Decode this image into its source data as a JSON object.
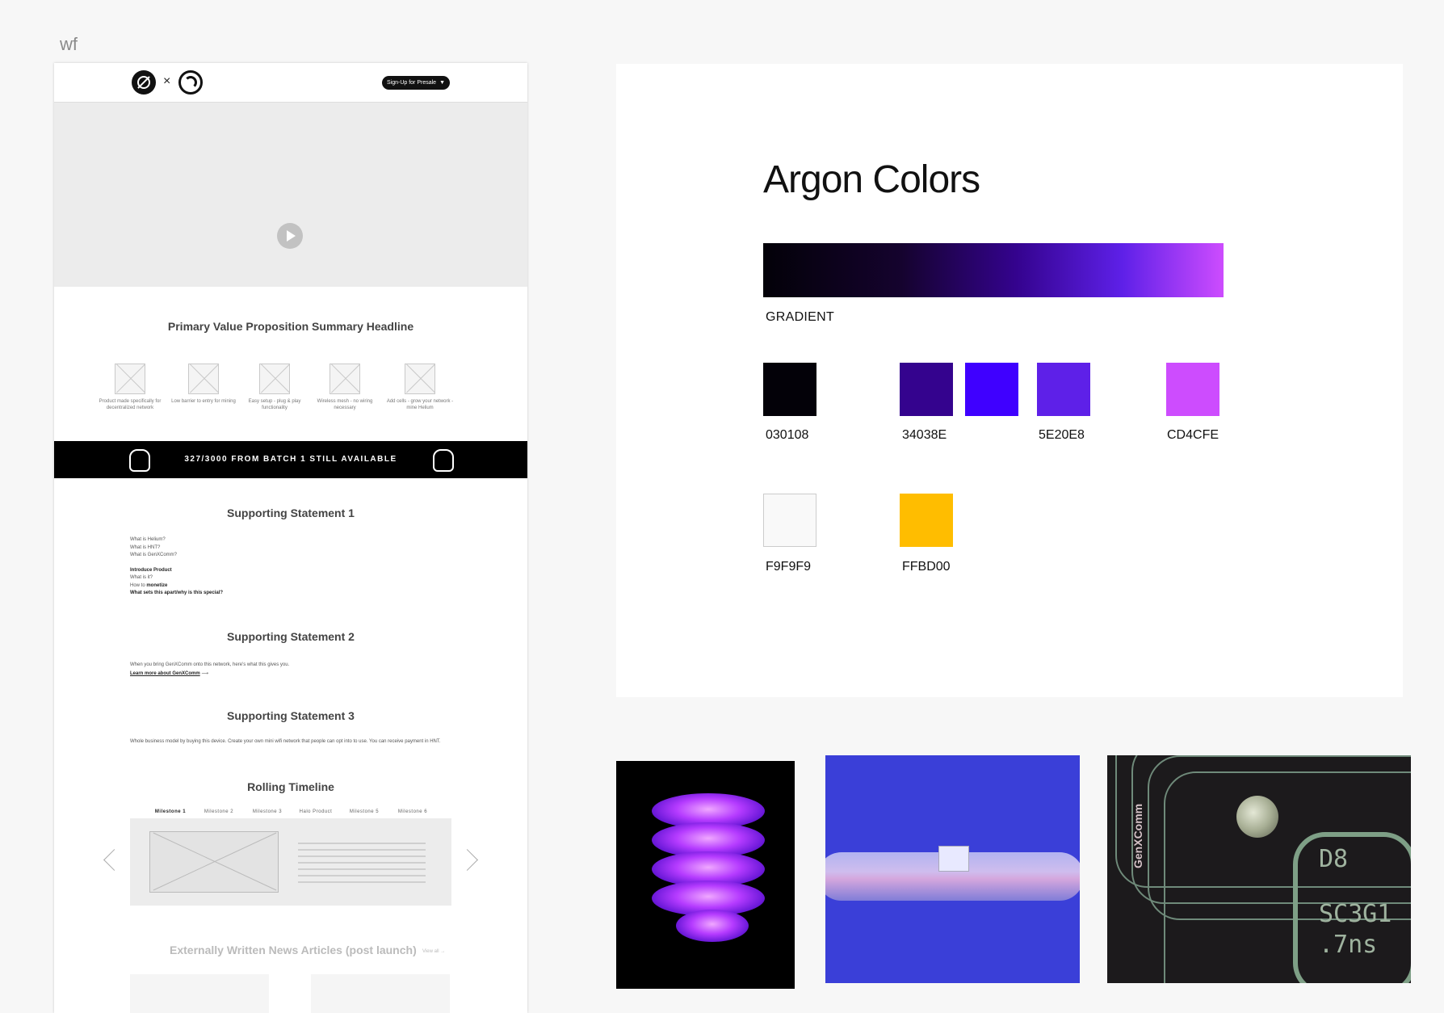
{
  "frame_label": "wf",
  "wireframe": {
    "nav": {
      "separator": "×",
      "presale_label": "Sign-Up for Presale",
      "presale_caret": "▼"
    },
    "value_prop_title": "Primary Value Proposition Summary Headline",
    "features": [
      "Product made specifically for decentralized network",
      "Low barrier to entry for mining",
      "Easy setup - plug & play functionality",
      "Wireless mesh - no wiring necessary",
      "Add cells - grow your network - mine Helium"
    ],
    "banner_text": "327/3000 FROM BATCH 1 STILL AVAILABLE",
    "support1": {
      "title": "Supporting Statement 1",
      "lines": [
        "What is Helium?",
        "What is HNT?",
        "What is GenXComm?"
      ],
      "intro": "Introduce Product",
      "intro_lines_1": "What is it?",
      "how_to": "How to ",
      "monetize": "monetize",
      "special": "What sets this apart/why is this special?"
    },
    "support2": {
      "title": "Supporting Statement 2",
      "body": "When you bring GenXComm onto this network, here's what this gives you.",
      "link": "Learn more about GenXComm",
      "link_arrow": "⟶"
    },
    "support3": {
      "title": "Supporting Statement 3",
      "body": "Whole business model by buying this device. Create your own mini wifi network that people can opt into to use. You can receive payment in HNT."
    },
    "timeline": {
      "title": "Rolling Timeline",
      "milestones": [
        "Milestone 1",
        "Milestone 2",
        "Milestone 3",
        "Halo Product",
        "Milestone 5",
        "Milestone 6"
      ]
    },
    "news": {
      "title": "Externally Written News Articles (post launch)",
      "view_all": "View all  →"
    }
  },
  "palette": {
    "title": "Argon Colors",
    "gradient_label": "GRADIENT",
    "swatches": [
      {
        "hex": "030108",
        "color": "#030108",
        "label": "030108"
      },
      {
        "hex": "34038E",
        "color": "#34038E",
        "label": "34038E"
      },
      {
        "hex": "3F00FF",
        "color": "#3F00FF",
        "label": ""
      },
      {
        "hex": "5E20E8",
        "color": "#5E20E8",
        "label": "5E20E8"
      },
      {
        "hex": "CD4CFE",
        "color": "#CD4CFE",
        "label": "CD4CFE"
      },
      {
        "hex": "F9F9F9",
        "color": "#F9F9F9",
        "label": "F9F9F9"
      },
      {
        "hex": "FFBD00",
        "color": "#FFBD00",
        "label": "FFBD00"
      }
    ]
  },
  "photos": {
    "chip_text": [
      "D8",
      "SC3G1",
      ".7ns"
    ],
    "brand": "GenXComm"
  }
}
